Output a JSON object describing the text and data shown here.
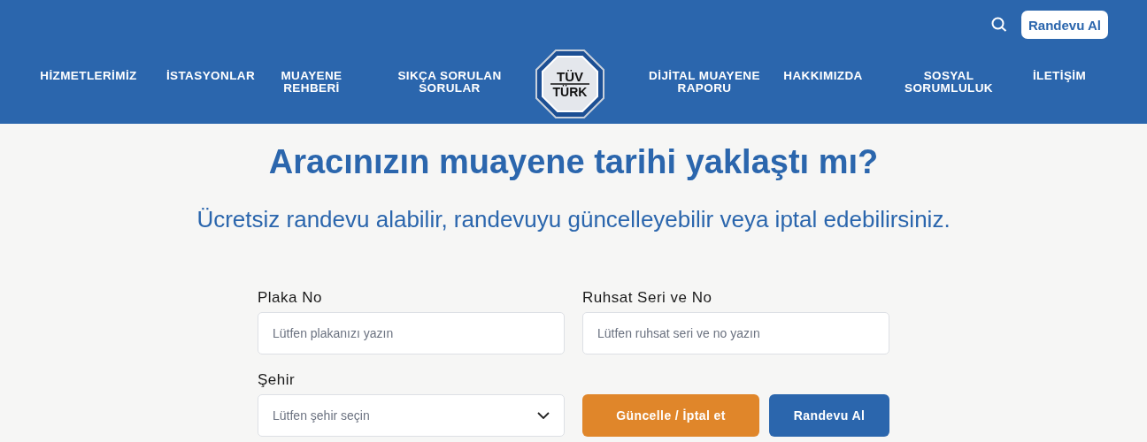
{
  "header": {
    "cta": "Randevu Al",
    "nav_left": [
      {
        "label": "HİZMETLERİMİZ"
      },
      {
        "label": "İSTASYONLAR"
      },
      {
        "label": "MUAYENE REHBERİ"
      },
      {
        "label": "SIKÇA SORULAN SORULAR"
      }
    ],
    "logo": {
      "line_1": "TÜV",
      "line_2": "TÜRK"
    },
    "nav_right": [
      {
        "label": "DİJİTAL MUAYENE RAPORU"
      },
      {
        "label": "HAKKIMIZDA"
      },
      {
        "label": "SOSYAL SORUMLULUK"
      },
      {
        "label": "İLETİŞİM"
      }
    ]
  },
  "hero": {
    "title": "Aracınızın muayene tarihi yaklaştı mı?",
    "subtitle": "Ücretsiz randevu alabilir, randevuyu güncelleyebilir veya iptal edebilirsiniz."
  },
  "form": {
    "fields": [
      {
        "label": "Plaka No",
        "placeholder": "Lütfen plakanızı yazın",
        "kind": "text"
      },
      {
        "label": "Ruhsat Seri ve No",
        "placeholder": "Lütfen ruhsat seri ve no yazın",
        "kind": "text"
      },
      {
        "label": "Şehir",
        "placeholder": "Lütfen şehir seçin",
        "kind": "select"
      }
    ],
    "buttons": [
      {
        "label": "Güncelle / İptal et",
        "kind": "secondary"
      },
      {
        "label": "Randevu Al",
        "kind": "primary"
      }
    ]
  }
}
